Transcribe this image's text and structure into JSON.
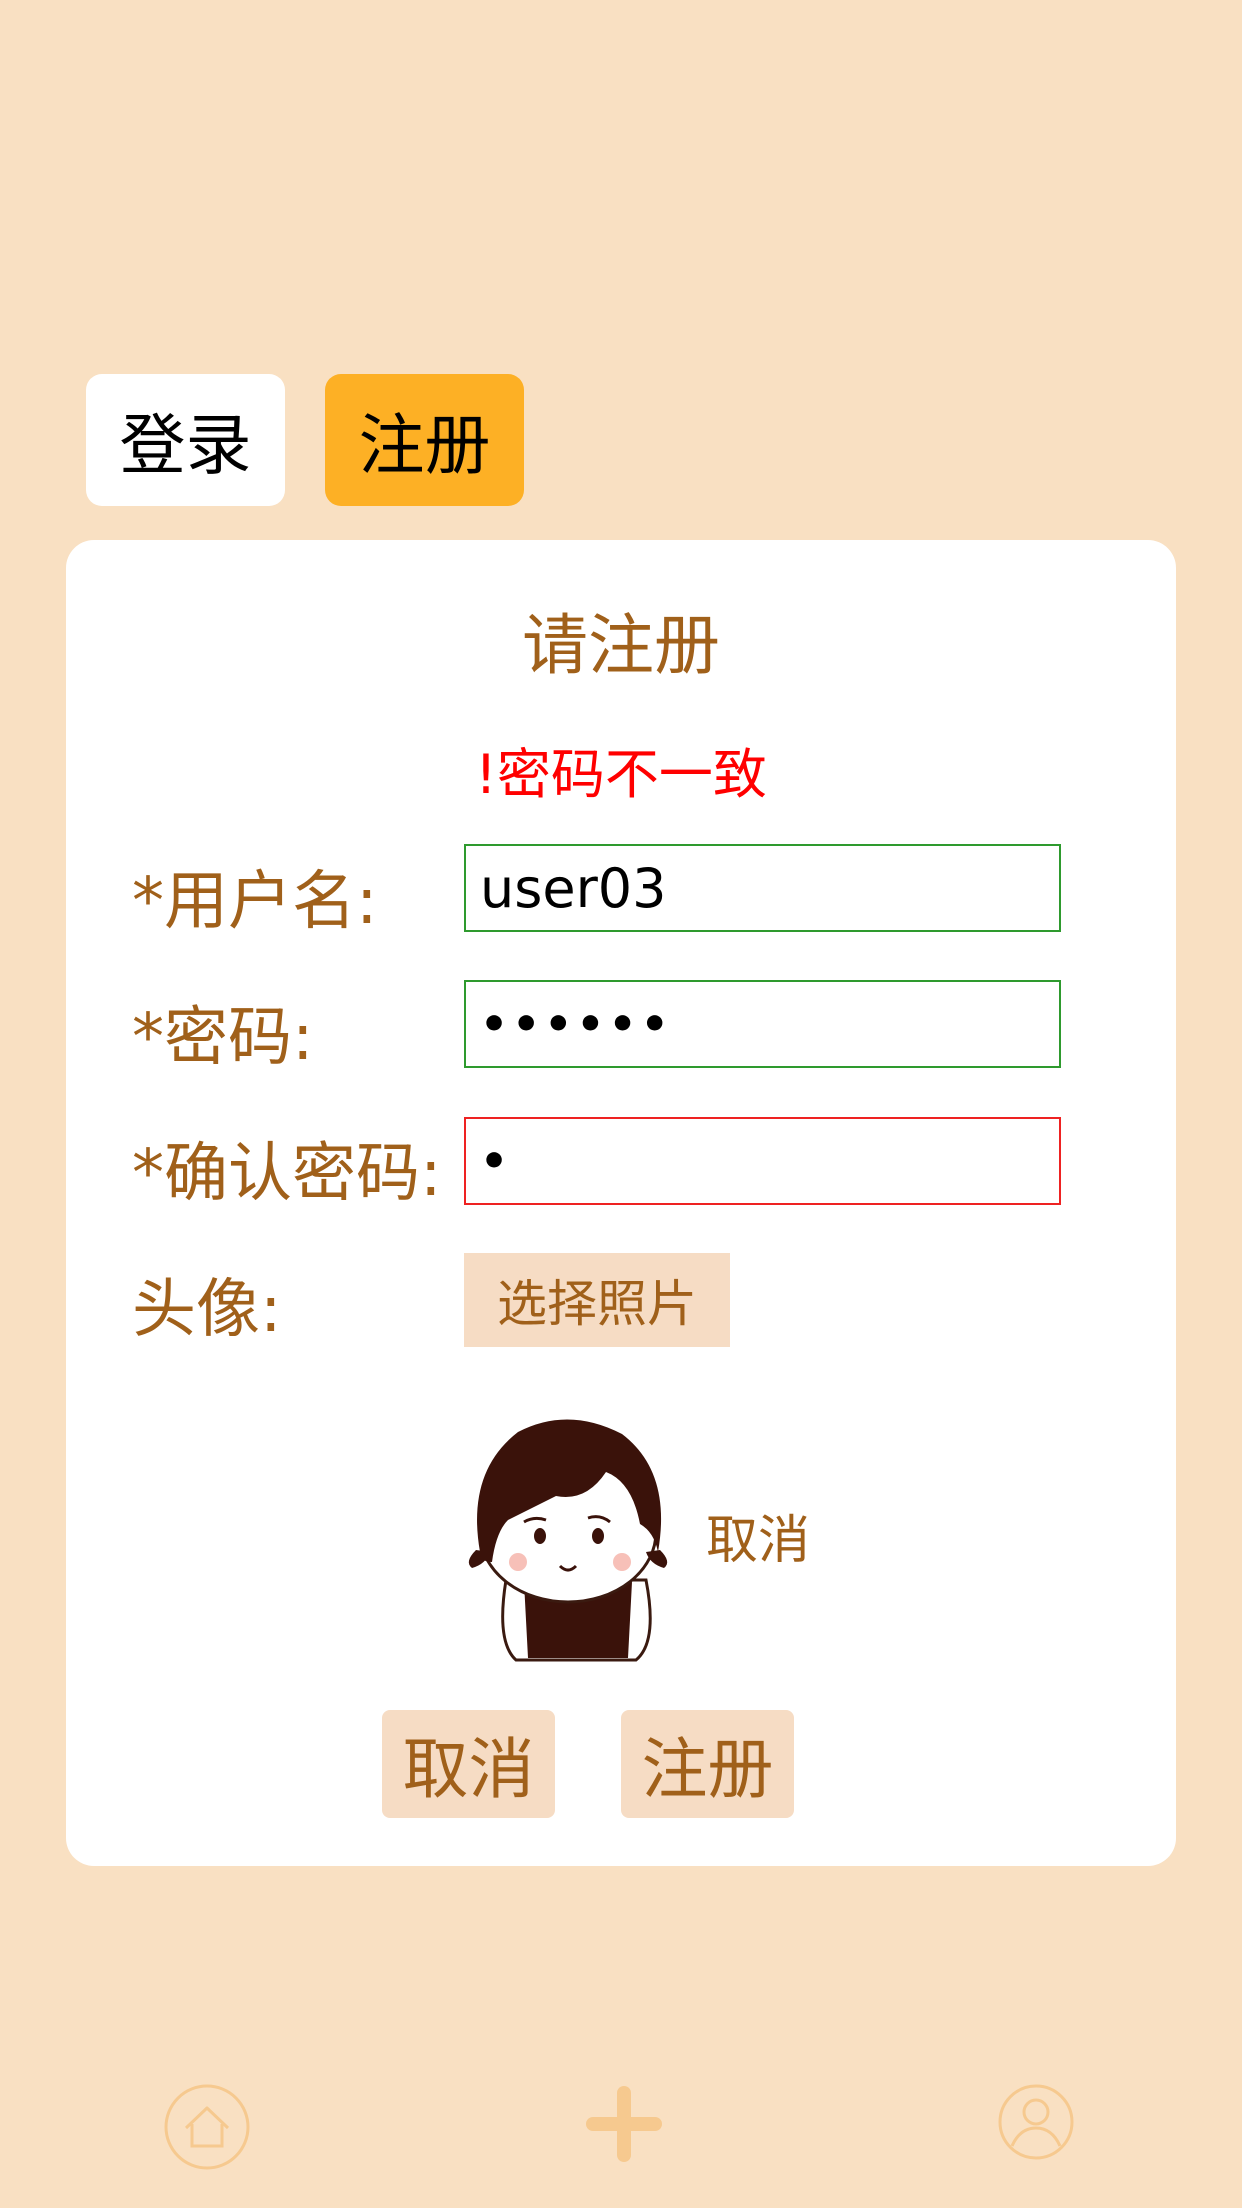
{
  "tabs": {
    "login_label": "登录",
    "register_label": "注册"
  },
  "form": {
    "title": "请注册",
    "error": "!密码不一致",
    "username_label": "*用户名:",
    "username_value": "user03",
    "password_label": "*密码:",
    "password_value": "••••••",
    "confirm_label": "*确认密码:",
    "confirm_value": "•",
    "avatar_label": "头像:",
    "choose_photo_label": "选择照片",
    "avatar_cancel_label": "取消",
    "cancel_button_label": "取消",
    "register_button_label": "注册"
  },
  "colors": {
    "background": "#f9e0c2",
    "accent": "#fdb025",
    "label_brown": "#a0601a",
    "error_red": "#ff0000",
    "valid_green": "#2e9a2e"
  },
  "bottom_nav": {
    "icons": [
      "home-icon",
      "add-icon",
      "user-icon"
    ]
  }
}
